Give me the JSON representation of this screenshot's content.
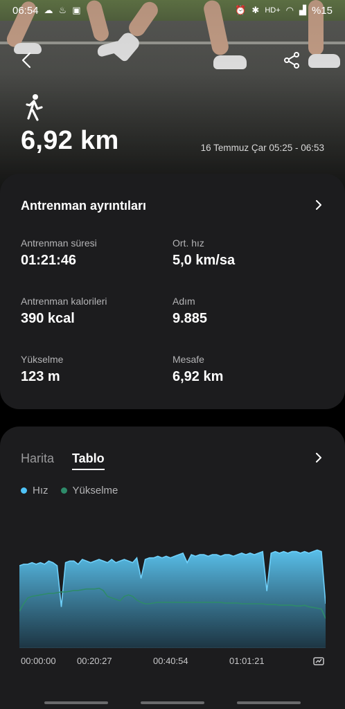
{
  "status_bar": {
    "time": "06:54",
    "network": "HD+",
    "battery": "%15"
  },
  "hero": {
    "distance": "6,92 km",
    "date_range": "16 Temmuz Çar 05:25 - 06:53"
  },
  "workout_details": {
    "title": "Antrenman ayrıntıları",
    "metrics": [
      {
        "label": "Antrenman süresi",
        "value": "01:21:46"
      },
      {
        "label": "Ort. hız",
        "value": "5,0 km/sa"
      },
      {
        "label": "Antrenman kalorileri",
        "value": "390 kcal"
      },
      {
        "label": "Adım",
        "value": "9.885"
      },
      {
        "label": "Yükselme",
        "value": "123 m"
      },
      {
        "label": "Mesafe",
        "value": "6,92 km"
      }
    ]
  },
  "chart_card": {
    "tabs": [
      "Harita",
      "Tablo"
    ],
    "active_tab": "Tablo",
    "legend": [
      {
        "name": "Hız",
        "color": "#4fc3f7"
      },
      {
        "name": "Yükselme",
        "color": "#2e8b6a"
      }
    ],
    "x_ticks": [
      "00:00:00",
      "00:20:27",
      "00:40:54",
      "01:01:21"
    ]
  },
  "chart_data": {
    "type": "area",
    "xlabel": "",
    "ylabel": "",
    "x_ticks": [
      "00:00:00",
      "00:20:27",
      "00:40:54",
      "01:01:21"
    ],
    "series": [
      {
        "name": "Hız",
        "color": "#4fc3f7",
        "values": [
          5.2,
          5.3,
          5.3,
          5.4,
          5.3,
          5.4,
          5.3,
          5.5,
          5.4,
          5.2,
          2.6,
          5.4,
          5.5,
          5.5,
          5.3,
          5.6,
          5.5,
          5.4,
          5.5,
          5.6,
          5.5,
          5.4,
          5.6,
          5.4,
          5.5,
          5.6,
          5.5,
          5.4,
          5.7,
          4.4,
          5.6,
          5.7,
          5.7,
          5.8,
          5.7,
          5.8,
          5.7,
          5.8,
          5.9,
          6.0,
          5.4,
          5.9,
          5.8,
          5.9,
          5.9,
          5.8,
          5.9,
          5.9,
          5.8,
          5.9,
          5.9,
          5.8,
          5.9,
          6.0,
          5.9,
          6.0,
          5.9,
          6.0,
          6.1,
          3.6,
          6.0,
          6.1,
          6.0,
          6.1,
          6.0,
          6.1,
          6.1,
          6.0,
          6.1,
          6.0,
          6.1,
          6.2,
          6.1,
          2.8
        ],
        "ylim": [
          0,
          7
        ]
      },
      {
        "name": "Yükselme",
        "color": "#2e8b6a",
        "values": [
          50,
          60,
          68,
          70,
          71,
          72,
          73,
          74,
          74,
          75,
          76,
          76,
          77,
          78,
          78,
          79,
          80,
          80,
          80,
          81,
          78,
          70,
          68,
          66,
          64,
          70,
          72,
          70,
          65,
          62,
          60,
          60,
          61,
          62,
          62,
          62,
          62,
          62,
          62,
          62,
          62,
          62,
          62,
          62,
          62,
          62,
          62,
          62,
          62,
          61,
          61,
          61,
          61,
          60,
          60,
          60,
          60,
          60,
          60,
          59,
          59,
          59,
          58,
          58,
          58,
          58,
          57,
          57,
          58,
          56,
          55,
          54,
          53,
          40
        ],
        "ylim": [
          0,
          150
        ]
      }
    ]
  }
}
